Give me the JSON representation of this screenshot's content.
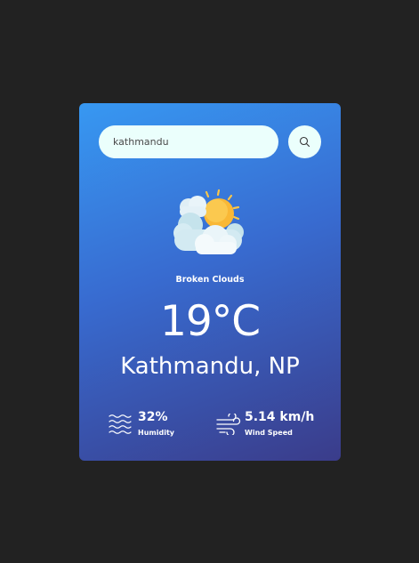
{
  "search": {
    "value": "kathmandu",
    "placeholder": ""
  },
  "weather": {
    "icon": "sun-behind-clouds-icon",
    "condition": "Broken Clouds",
    "temperature": "19°C",
    "location": "Kathmandu, NP"
  },
  "details": {
    "humidity": {
      "value": "32%",
      "label": "Humidity",
      "icon": "humidity-waves-icon"
    },
    "wind": {
      "value": "5.14 km/h",
      "label": "Wind Speed",
      "icon": "wind-icon"
    }
  },
  "colors": {
    "background": "#222222",
    "card_top": "#3798f2",
    "card_bottom": "#3a3c8a",
    "input_bg": "#ebfffc",
    "sun": "#f9b836"
  }
}
